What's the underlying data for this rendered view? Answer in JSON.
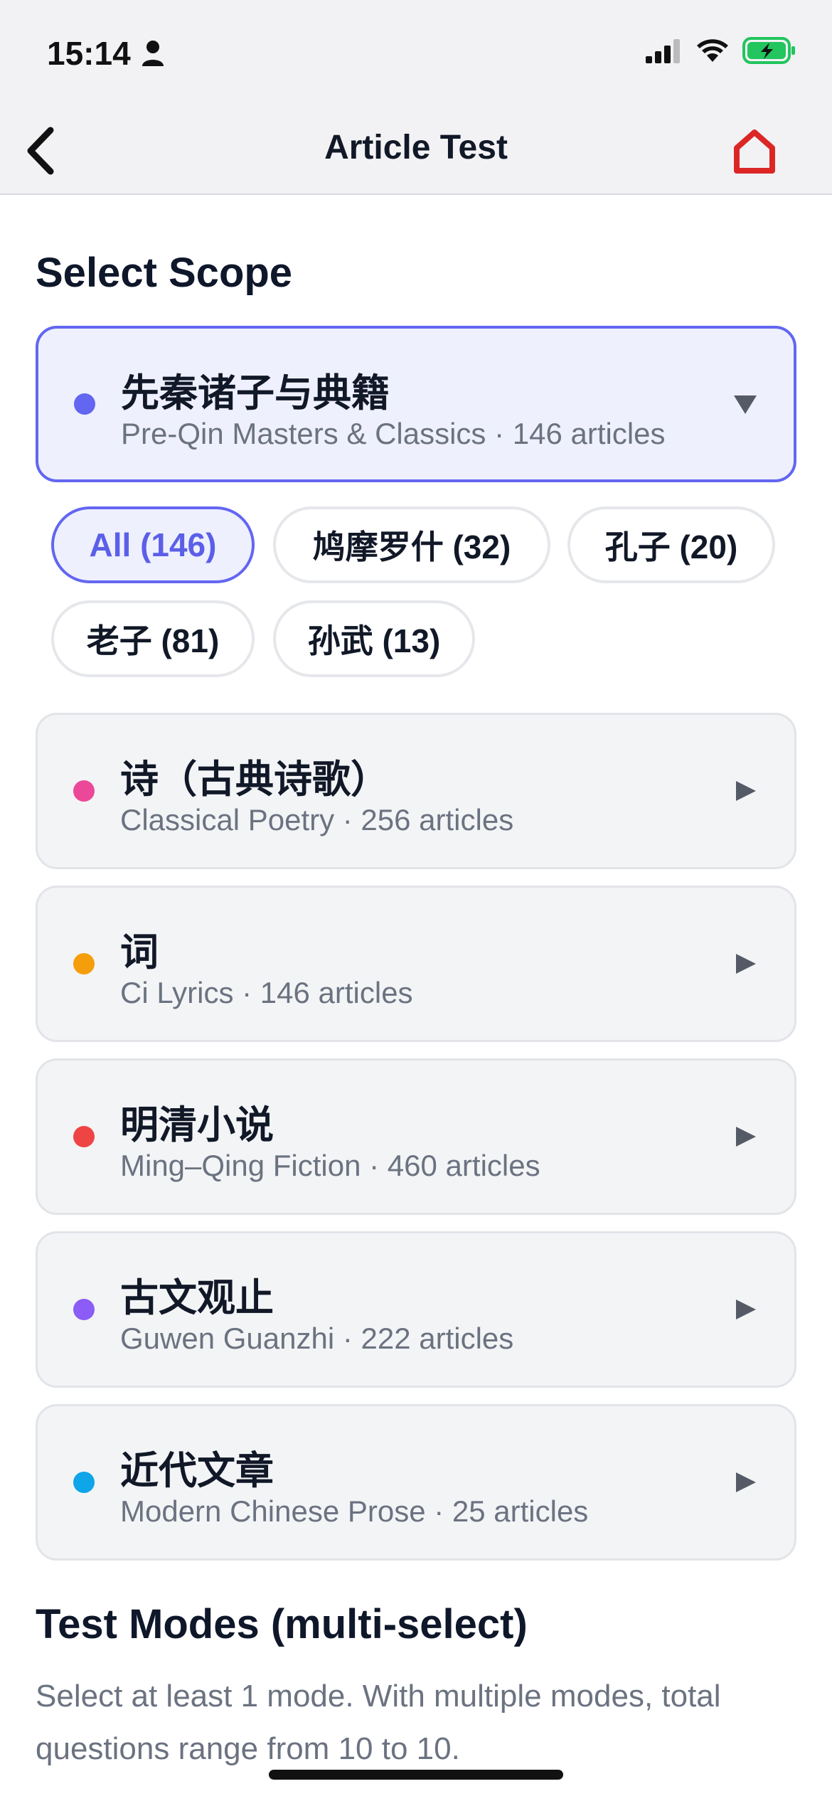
{
  "status_bar": {
    "time": "15:14"
  },
  "nav": {
    "title": "Article Test"
  },
  "scope_section": {
    "title": "Select Scope"
  },
  "scopes": [
    {
      "title": "先秦诸子与典籍",
      "subtitle": "Pre-Qin Masters & Classics · 146 articles",
      "dot_color": "#6366f1",
      "selected": true
    },
    {
      "title": "诗（古典诗歌）",
      "subtitle": "Classical Poetry · 256 articles",
      "dot_color": "#ec4899",
      "selected": false
    },
    {
      "title": "词",
      "subtitle": "Ci Lyrics · 146 articles",
      "dot_color": "#f59e0b",
      "selected": false
    },
    {
      "title": "明清小说",
      "subtitle": "Ming–Qing Fiction · 460 articles",
      "dot_color": "#ef4444",
      "selected": false
    },
    {
      "title": "古文观止",
      "subtitle": "Guwen Guanzhi · 222 articles",
      "dot_color": "#8b5cf6",
      "selected": false
    },
    {
      "title": "近代文章",
      "subtitle": "Modern Chinese Prose · 25 articles",
      "dot_color": "#0ea5e9",
      "selected": false
    }
  ],
  "chips": [
    {
      "label": "All (146)",
      "active": true
    },
    {
      "label": "鸠摩罗什 (32)",
      "active": false
    },
    {
      "label": "孔子 (20)",
      "active": false
    },
    {
      "label": "老子 (81)",
      "active": false
    },
    {
      "label": "孙武 (13)",
      "active": false
    }
  ],
  "modes_section": {
    "title": "Test Modes (multi-select)",
    "description": "Select at least 1 mode. With multiple modes, total questions range from 10 to 10."
  },
  "colors": {
    "accent": "#6366f1",
    "home_icon": "#dc2626",
    "battery": "#22c55e"
  }
}
